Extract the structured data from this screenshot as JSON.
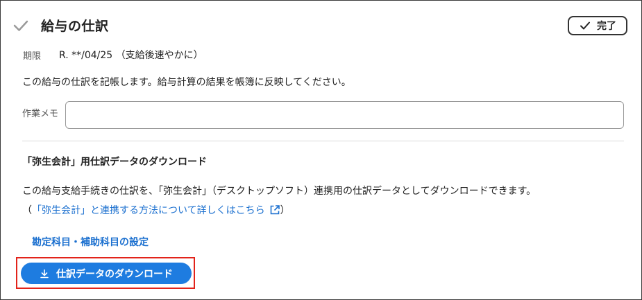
{
  "task": {
    "title": "給与の仕訳",
    "done_label": "完了",
    "due_label": "期限",
    "due_value": "R. **/04/25 （支給後速やかに）",
    "description": "この給与の仕訳を記帳します。給与計算の結果を帳簿に反映してください。",
    "memo_label": "作業メモ",
    "memo_value": "",
    "memo_placeholder": ""
  },
  "download_section": {
    "title": "「弥生会計」用仕訳データのダウンロード",
    "description": "この給与支給手続きの仕訳を、「弥生会計」（デスクトップソフト）連携用の仕訳データとしてダウンロードできます。",
    "link_prefix": "（",
    "link_text": "「弥生会計」と連携する方法について詳しくはこちら",
    "link_suffix": "）",
    "account_settings_label": "勘定科目・補助科目の設定",
    "download_button_label": "仕訳データのダウンロード"
  },
  "colors": {
    "accent": "#1e7ce0",
    "link": "#1a6fcf",
    "highlight": "#e2231a"
  },
  "icons": {
    "header": "check-icon",
    "done": "check-icon",
    "link": "external-link-icon",
    "download": "download-icon"
  }
}
